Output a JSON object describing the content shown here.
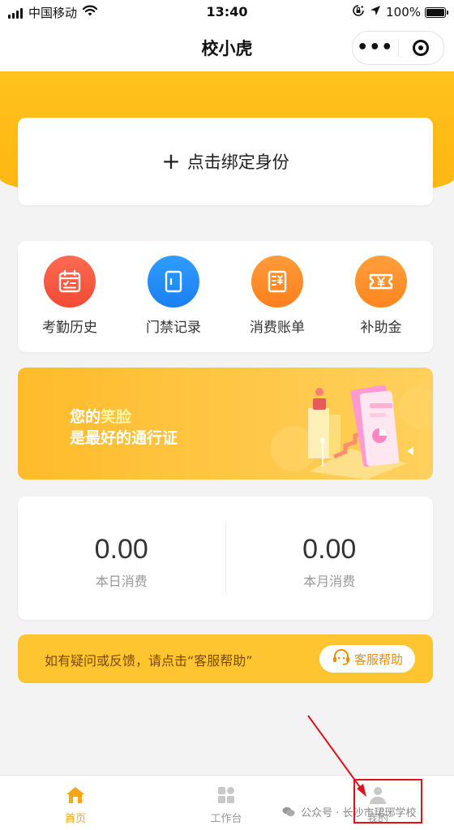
{
  "status_bar": {
    "carrier": "中国移动",
    "time": "13:40",
    "battery": "100%",
    "icons": [
      "signal-icon",
      "wifi-icon",
      "orientation-lock-icon",
      "location-icon",
      "battery-icon"
    ]
  },
  "nav": {
    "title": "校小虎",
    "more": "•••",
    "icons": [
      "more-icon",
      "close-mini-program-icon"
    ]
  },
  "bind_card": {
    "plus": "+",
    "label": "点击绑定身份"
  },
  "menu": {
    "items": [
      {
        "label": "考勤历史",
        "icon": "calendar-icon",
        "color": "#f24a35"
      },
      {
        "label": "门禁记录",
        "icon": "door-icon",
        "color": "#1a80f0"
      },
      {
        "label": "消费账单",
        "icon": "bill-icon",
        "color": "#ff7f1d"
      },
      {
        "label": "补助金",
        "icon": "ticket-icon",
        "color": "#ff861f"
      }
    ]
  },
  "promo": {
    "prefix": "您的",
    "highlight": "笑脸",
    "line2": "是最好的通行证"
  },
  "stats": {
    "today_value": "0.00",
    "today_label": "本日消费",
    "month_value": "0.00",
    "month_label": "本月消费"
  },
  "help": {
    "text": "如有疑问或反馈，请点击“客服帮助”",
    "button": "客服帮助",
    "icon": "headset-icon"
  },
  "tabs": [
    {
      "label": "首页",
      "icon": "home-icon",
      "active": true
    },
    {
      "label": "工作台",
      "icon": "grid-icon",
      "active": false
    },
    {
      "label": "我的",
      "icon": "user-icon",
      "active": false
    }
  ],
  "watermark": "公众号 · 长沙市珺琊学校",
  "colors": {
    "brand_yellow": "#ffc21e",
    "active_tab": "#ffa414",
    "highlight_box": "#e0121b"
  }
}
